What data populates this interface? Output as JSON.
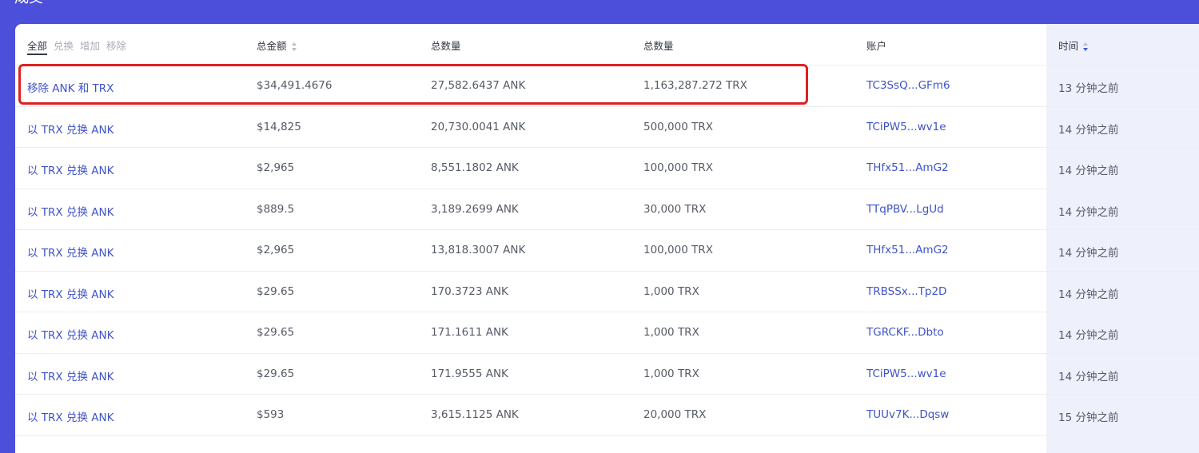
{
  "page": {
    "title": "成交"
  },
  "table": {
    "filters": [
      "全部",
      "兑换",
      "增加",
      "移除"
    ],
    "active_filter": "全部",
    "headers": {
      "total_value": "总金额",
      "amount_a": "总数量",
      "amount_b": "总数量",
      "account": "账户",
      "time": "时间"
    },
    "rows": [
      {
        "action": "移除 ANK 和 TRX",
        "total_value": "$34,491.4676",
        "amount_a": "27,582.6437 ANK",
        "amount_b": "1,163,287.272 TRX",
        "account": "TC3SsQ...GFm6",
        "time": "13 分钟之前"
      },
      {
        "action": "以 TRX 兑换 ANK",
        "total_value": "$14,825",
        "amount_a": "20,730.0041 ANK",
        "amount_b": "500,000 TRX",
        "account": "TCiPW5...wv1e",
        "time": "14 分钟之前"
      },
      {
        "action": "以 TRX 兑换 ANK",
        "total_value": "$2,965",
        "amount_a": "8,551.1802 ANK",
        "amount_b": "100,000 TRX",
        "account": "THfx51...AmG2",
        "time": "14 分钟之前"
      },
      {
        "action": "以 TRX 兑换 ANK",
        "total_value": "$889.5",
        "amount_a": "3,189.2699 ANK",
        "amount_b": "30,000 TRX",
        "account": "TTqPBV...LgUd",
        "time": "14 分钟之前"
      },
      {
        "action": "以 TRX 兑换 ANK",
        "total_value": "$2,965",
        "amount_a": "13,818.3007 ANK",
        "amount_b": "100,000 TRX",
        "account": "THfx51...AmG2",
        "time": "14 分钟之前"
      },
      {
        "action": "以 TRX 兑换 ANK",
        "total_value": "$29.65",
        "amount_a": "170.3723 ANK",
        "amount_b": "1,000 TRX",
        "account": "TRBSSx...Tp2D",
        "time": "14 分钟之前"
      },
      {
        "action": "以 TRX 兑换 ANK",
        "total_value": "$29.65",
        "amount_a": "171.1611 ANK",
        "amount_b": "1,000 TRX",
        "account": "TGRCKF...Dbto",
        "time": "14 分钟之前"
      },
      {
        "action": "以 TRX 兑换 ANK",
        "total_value": "$29.65",
        "amount_a": "171.9555 ANK",
        "amount_b": "1,000 TRX",
        "account": "TCiPW5...wv1e",
        "time": "14 分钟之前"
      },
      {
        "action": "以 TRX 兑换 ANK",
        "total_value": "$593",
        "amount_a": "3,615.1125 ANK",
        "amount_b": "20,000 TRX",
        "account": "TUUv7K...Dqsw",
        "time": "15 分钟之前"
      }
    ]
  },
  "colors": {
    "background": "#4b4fd9",
    "link": "#3f53c9",
    "highlight_border": "#e02020",
    "time_column_bg": "#eef0fb"
  }
}
